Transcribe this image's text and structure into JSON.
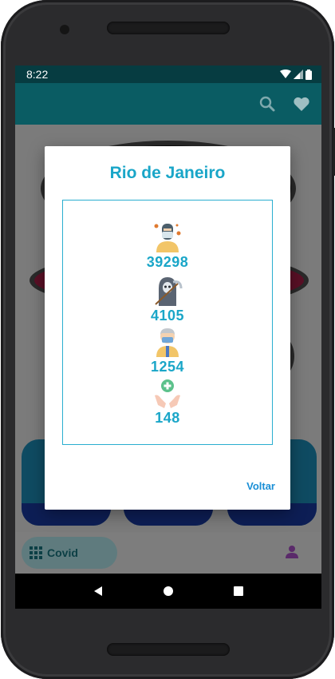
{
  "status_bar": {
    "time": "8:22"
  },
  "app_bar": {
    "icons": [
      "search-icon",
      "heart-icon"
    ]
  },
  "bottom_nav": {
    "covid_label": "Covid"
  },
  "dialog": {
    "title": "Rio de Janeiro",
    "stats": [
      {
        "icon": "masked-person-icon",
        "value": "39298"
      },
      {
        "icon": "grim-reaper-icon",
        "value": "4105"
      },
      {
        "icon": "elderly-masked-person-icon",
        "value": "1254"
      },
      {
        "icon": "healing-hands-icon",
        "value": "148"
      }
    ],
    "action_label": "Voltar"
  },
  "colors": {
    "accent": "#1aa6c8",
    "app_bar": "#0a5c63",
    "status_bar": "#063c41",
    "action": "#1a8fd6"
  }
}
